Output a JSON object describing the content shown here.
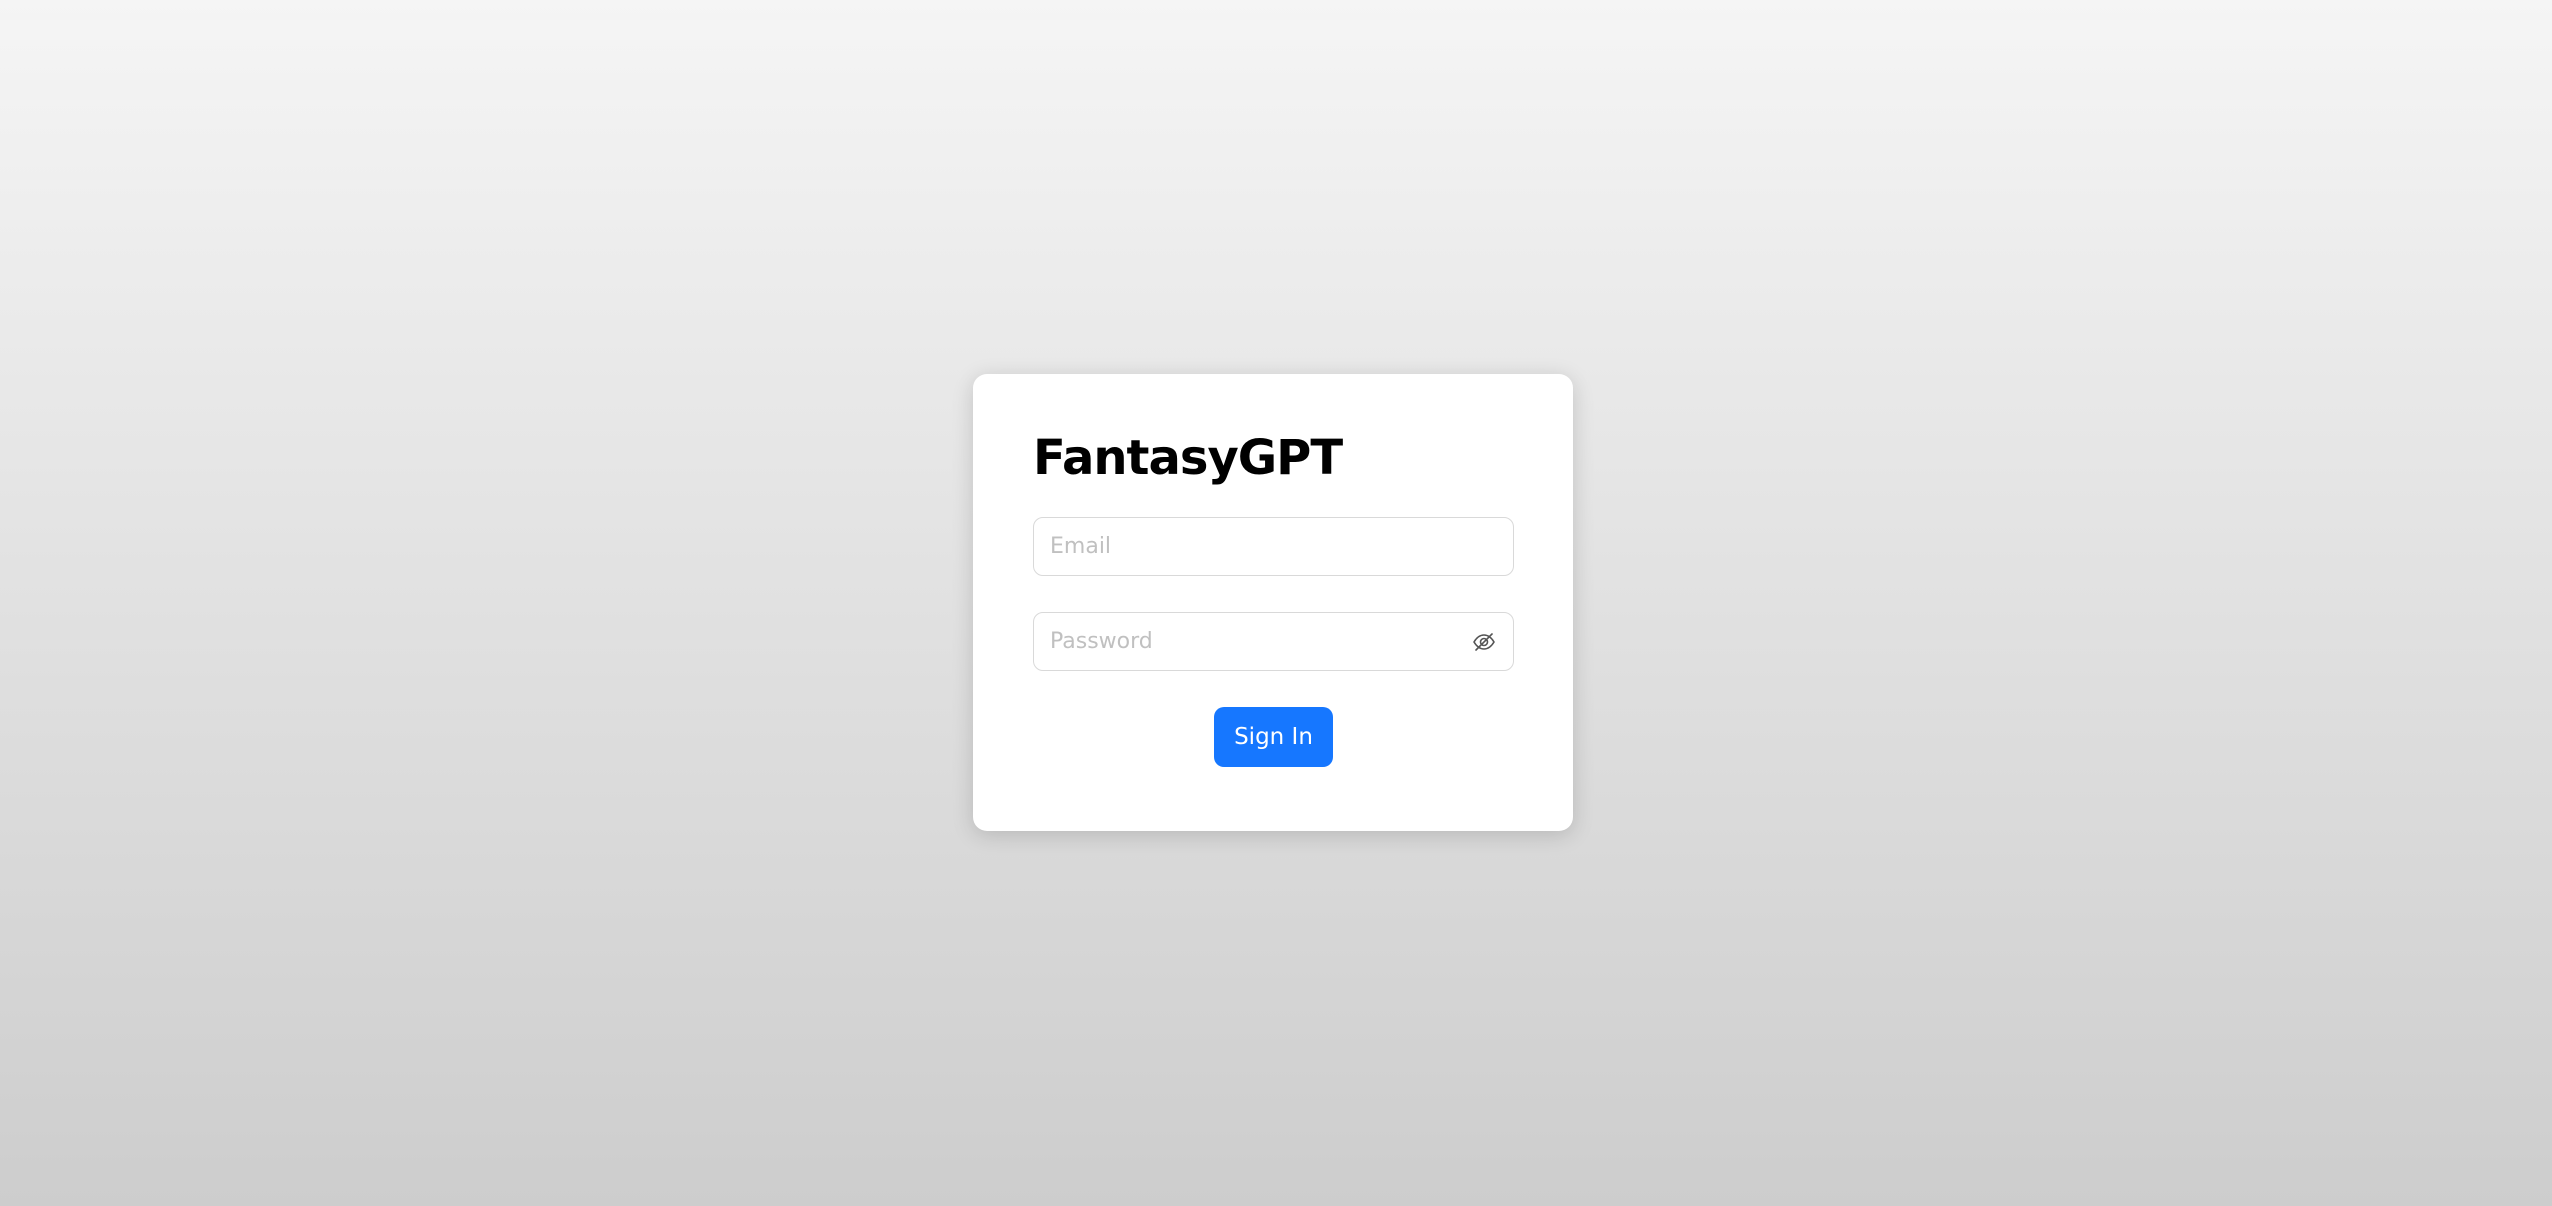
{
  "login": {
    "title": "FantasyGPT",
    "email": {
      "placeholder": "Email",
      "value": ""
    },
    "password": {
      "placeholder": "Password",
      "value": "",
      "visibility_icon": "eye-off-icon"
    },
    "submit_label": "Sign In"
  },
  "colors": {
    "primary": "#1677ff",
    "card_background": "#ffffff",
    "input_border": "#d9d9d9",
    "placeholder": "#c0c0c0",
    "page_gradient_top": "#f5f5f5",
    "page_gradient_bottom": "#cdcdcd"
  }
}
